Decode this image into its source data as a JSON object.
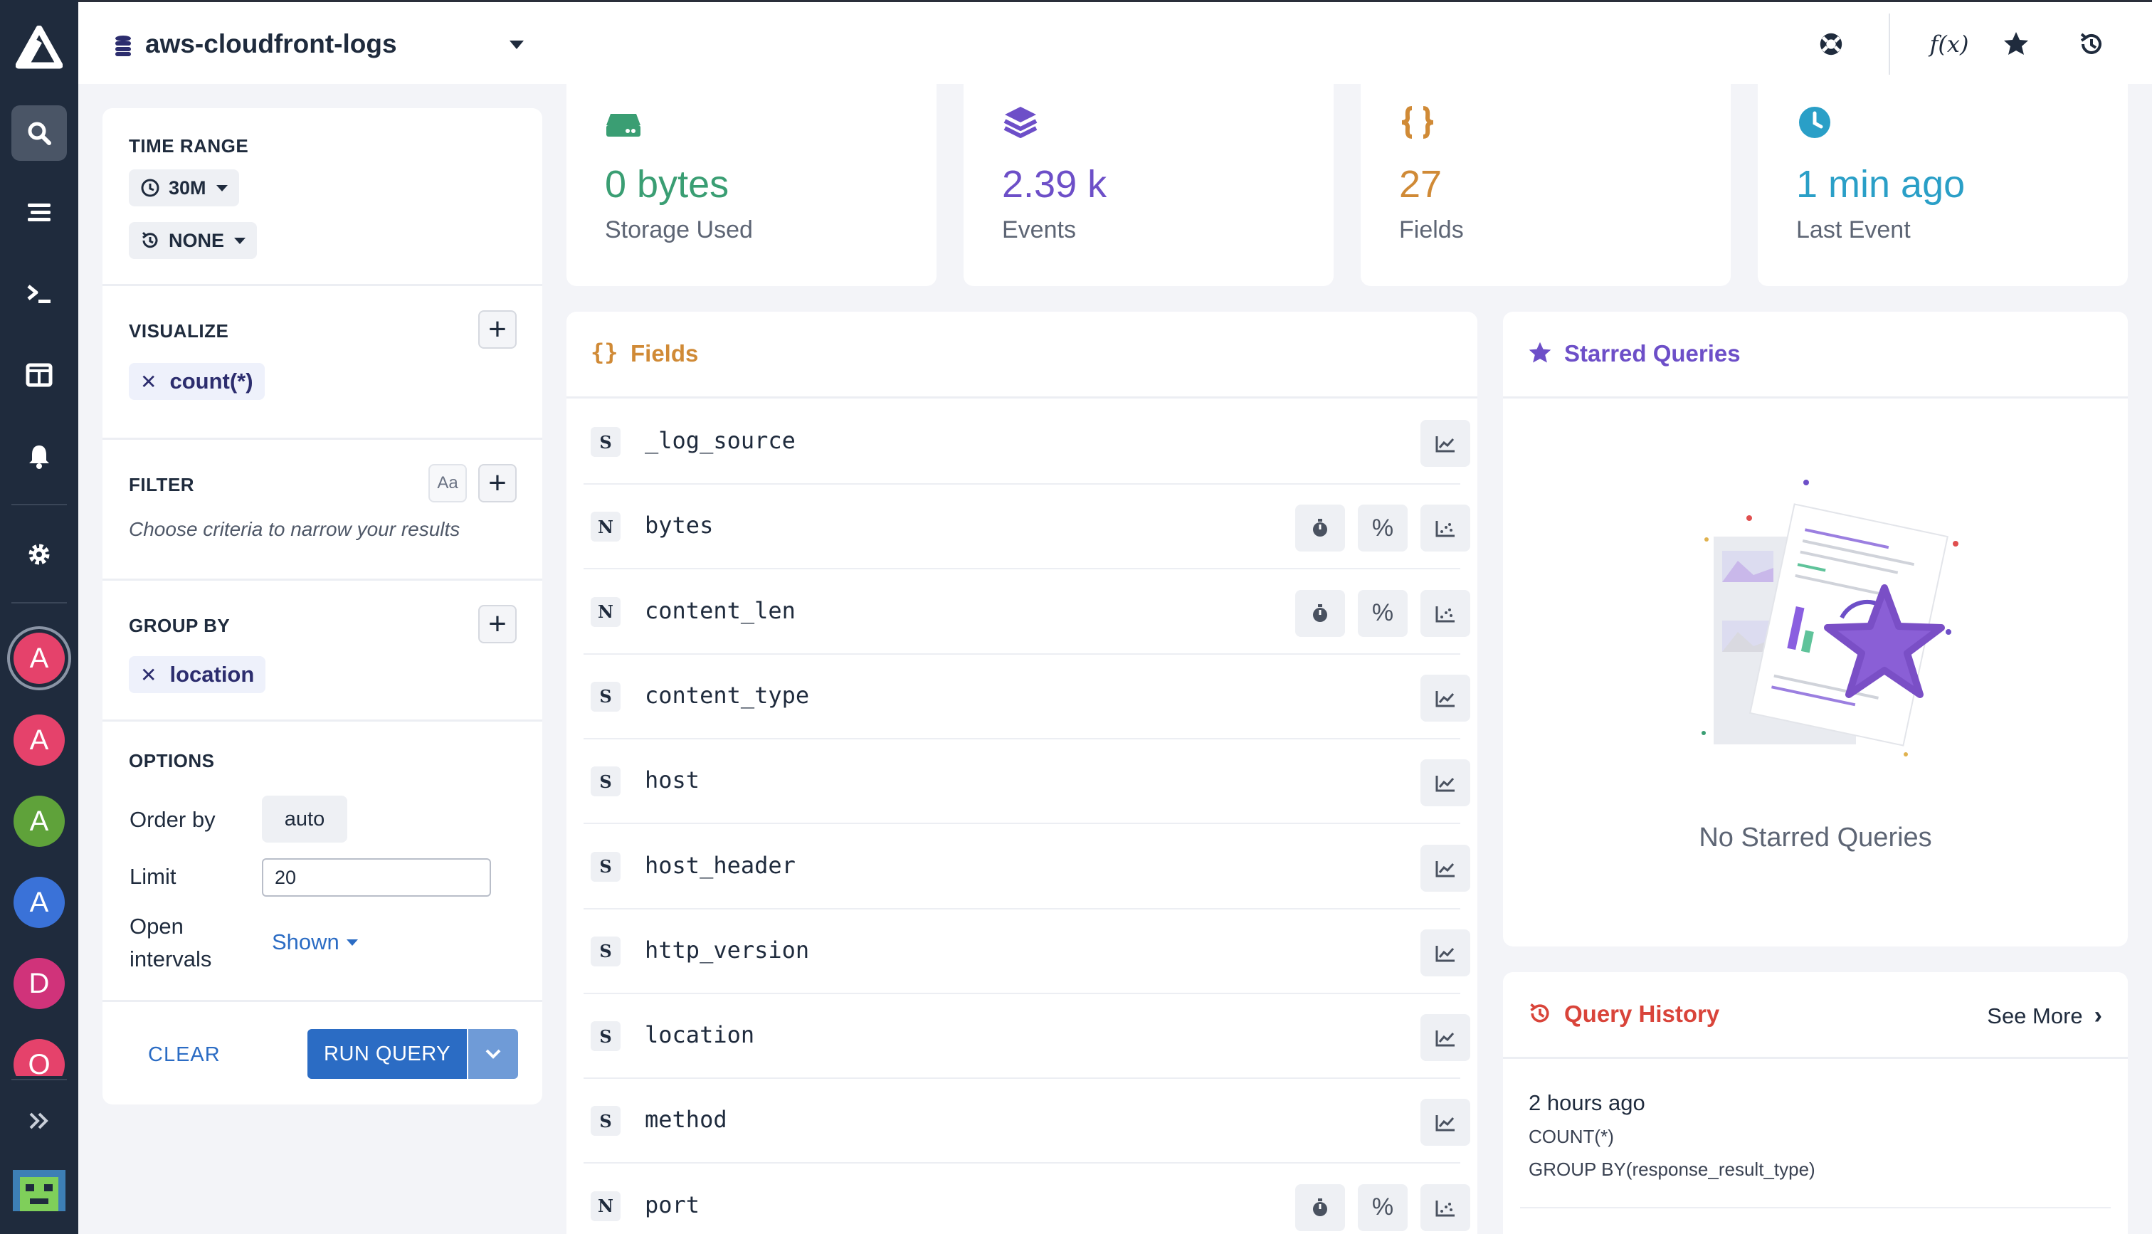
{
  "topbar": {
    "dataset": "aws-cloudfront-logs",
    "icons": [
      "help-lifebuoy-icon",
      "function-icon",
      "star-icon",
      "history-icon"
    ],
    "function_glyph": "f(x)"
  },
  "nav": {
    "items": [
      "search-icon",
      "stream-icon",
      "terminal-icon",
      "dashboard-icon",
      "bell-icon",
      "gear-icon"
    ],
    "avatars": [
      {
        "letter": "A",
        "color": "#e5426b"
      },
      {
        "letter": "A",
        "color": "#e5426b"
      },
      {
        "letter": "A",
        "color": "#5fa23a"
      },
      {
        "letter": "A",
        "color": "#3a72d8"
      },
      {
        "letter": "D",
        "color": "#d0337a"
      },
      {
        "letter": "O",
        "color": "#e5426b"
      }
    ]
  },
  "query": {
    "time_range_label": "TIME RANGE",
    "time_range_value": "30M",
    "compare_value": "NONE",
    "visualize_label": "VISUALIZE",
    "visualize_item": "count(*)",
    "filter_label": "FILTER",
    "filter_case_label": "Aa",
    "filter_hint": "Choose criteria to narrow your results",
    "group_by_label": "GROUP BY",
    "group_by_item": "location",
    "options_label": "OPTIONS",
    "order_by_label": "Order by",
    "order_by_value": "auto",
    "limit_label": "Limit",
    "limit_value": "20",
    "open_intervals_label_1": "Open",
    "open_intervals_label_2": "intervals",
    "open_intervals_value": "Shown",
    "clear_label": "CLEAR",
    "run_label": "RUN QUERY"
  },
  "stats": [
    {
      "value": "0 bytes",
      "label": "Storage Used",
      "color": "#3a9e73",
      "icon": "storage-icon"
    },
    {
      "value": "2.39 k",
      "label": "Events",
      "color": "#6d4fc8",
      "icon": "layers-icon"
    },
    {
      "value": "27",
      "label": "Fields",
      "color": "#d08a36",
      "icon": "braces-icon"
    },
    {
      "value": "1 min ago",
      "label": "Last Event",
      "color": "#2a9fc7",
      "icon": "clock-icon"
    }
  ],
  "fields": {
    "title": "Fields",
    "icon_glyph": "{}",
    "rows": [
      {
        "type": "S",
        "name": "_log_source"
      },
      {
        "type": "N",
        "name": "bytes"
      },
      {
        "type": "N",
        "name": "content_len"
      },
      {
        "type": "S",
        "name": "content_type"
      },
      {
        "type": "S",
        "name": "host"
      },
      {
        "type": "S",
        "name": "host_header"
      },
      {
        "type": "S",
        "name": "http_version"
      },
      {
        "type": "S",
        "name": "location"
      },
      {
        "type": "S",
        "name": "method"
      },
      {
        "type": "N",
        "name": "port"
      }
    ],
    "percent_glyph": "%"
  },
  "starred": {
    "title": "Starred Queries",
    "empty": "No Starred Queries"
  },
  "history": {
    "title": "Query History",
    "see_more": "See More",
    "entries": [
      {
        "time": "2 hours ago",
        "line1": "COUNT(*)",
        "line2": "GROUP BY(response_result_type)"
      }
    ]
  }
}
